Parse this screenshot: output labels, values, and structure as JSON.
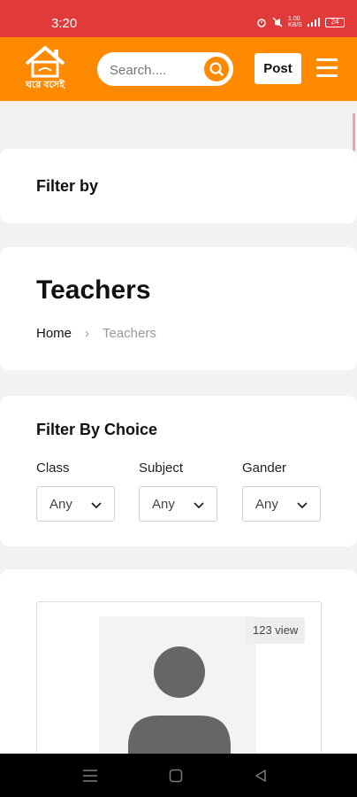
{
  "status_bar": {
    "time": "3:20",
    "network_speed": "1.00\nKB/S",
    "battery": "24"
  },
  "header": {
    "logo_text": "ঘরে বসেই",
    "search_placeholder": "Search....",
    "post_label": "Post"
  },
  "filter_section": {
    "title": "Filter by"
  },
  "page": {
    "title": "Teachers",
    "breadcrumb_home": "Home",
    "breadcrumb_separator": "›",
    "breadcrumb_current": "Teachers"
  },
  "choice": {
    "title": "Filter By Choice",
    "filters": [
      {
        "label": "Class",
        "value": "Any"
      },
      {
        "label": "Subject",
        "value": "Any"
      },
      {
        "label": "Gander",
        "value": "Any"
      }
    ]
  },
  "listing": {
    "view_count": "123 view"
  },
  "colors": {
    "status_bar": "#e03a3a",
    "brand_orange": "#ff8a00",
    "page_bg": "#f2f2f2"
  },
  "icons": [
    "alarm-icon",
    "mute-icon",
    "signal-icon",
    "battery-icon",
    "house-logo-icon",
    "search-icon",
    "hamburger-menu-icon",
    "chevron-right-icon",
    "chevron-down-icon",
    "avatar-icon",
    "recent-apps-icon",
    "home-icon",
    "back-icon"
  ]
}
